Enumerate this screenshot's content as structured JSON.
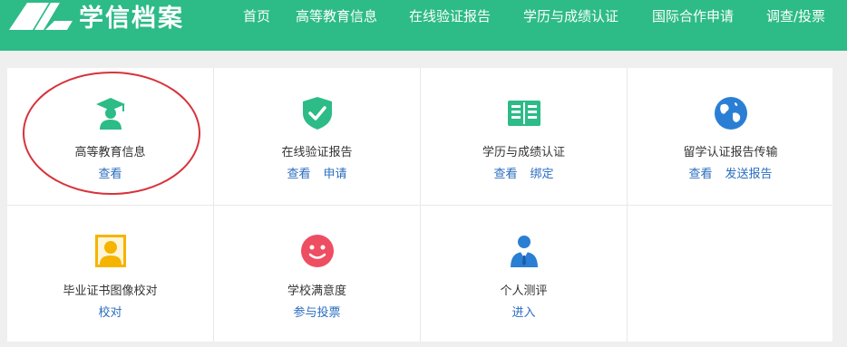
{
  "brand": {
    "name": "学信档案"
  },
  "nav": [
    {
      "label": "首页"
    },
    {
      "label": "高等教育信息"
    },
    {
      "label": "在线验证报告"
    },
    {
      "label": "学历与成绩认证"
    },
    {
      "label": "国际合作申请"
    },
    {
      "label": "调查/投票"
    }
  ],
  "services": [
    {
      "title": "高等教育信息",
      "icon": "graduate-icon",
      "links": [
        "查看"
      ]
    },
    {
      "title": "在线验证报告",
      "icon": "shield-check-icon",
      "links": [
        "查看",
        "申请"
      ]
    },
    {
      "title": "学历与成绩认证",
      "icon": "book-icon",
      "links": [
        "查看",
        "绑定"
      ]
    },
    {
      "title": "留学认证报告传输",
      "icon": "globe-icon",
      "links": [
        "查看",
        "发送报告"
      ]
    },
    {
      "title": "毕业证书图像校对",
      "icon": "portrait-icon",
      "links": [
        "校对"
      ]
    },
    {
      "title": "学校满意度",
      "icon": "smiley-icon",
      "links": [
        "参与投票"
      ]
    },
    {
      "title": "个人测评",
      "icon": "person-tie-icon",
      "links": [
        "进入"
      ]
    }
  ],
  "colors": {
    "brand_green": "#2dbb87",
    "link_blue": "#2a6dbf",
    "highlight_red": "#d8323a"
  }
}
